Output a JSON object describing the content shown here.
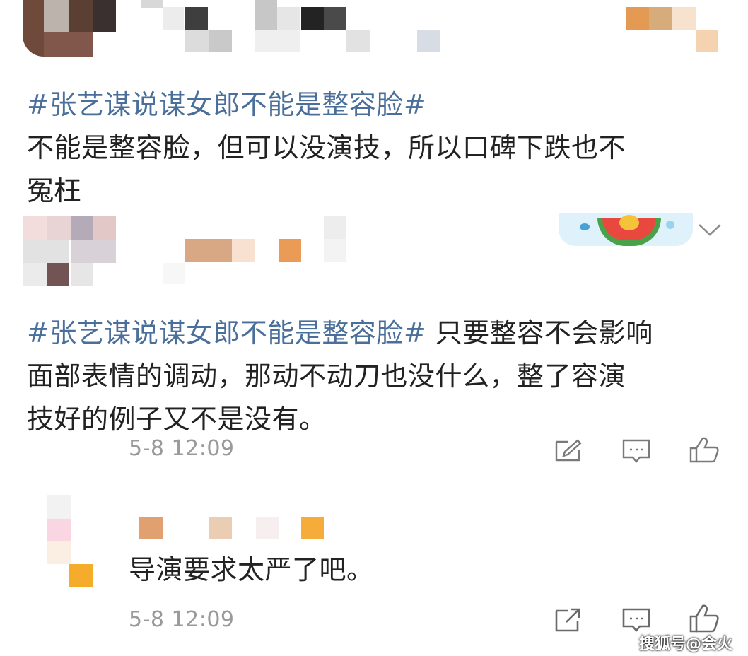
{
  "comments": [
    {
      "hashtag": "#张艺谋说谋女郎不能是整容脸#",
      "line1": "不能是整容脸，但可以没演技，所以口碑下跌也不",
      "line2": "冤枉"
    },
    {
      "hashtag": "#张艺谋说谋女郎不能是整容脸#",
      "line1_rest": "只要整容不会影响",
      "line2": "面部表情的调动，那动不动刀也没什么，整了容演",
      "line3": "技好的例子又不是没有。",
      "time": "5-8 12:09"
    }
  ],
  "reply": {
    "text": "导演要求太严了吧。",
    "time": "5-8 12:09"
  },
  "watermark": "搜狐号@会火",
  "icons": [
    "expand-icon",
    "edit-icon",
    "comment-icon",
    "like-icon",
    "share-icon"
  ]
}
